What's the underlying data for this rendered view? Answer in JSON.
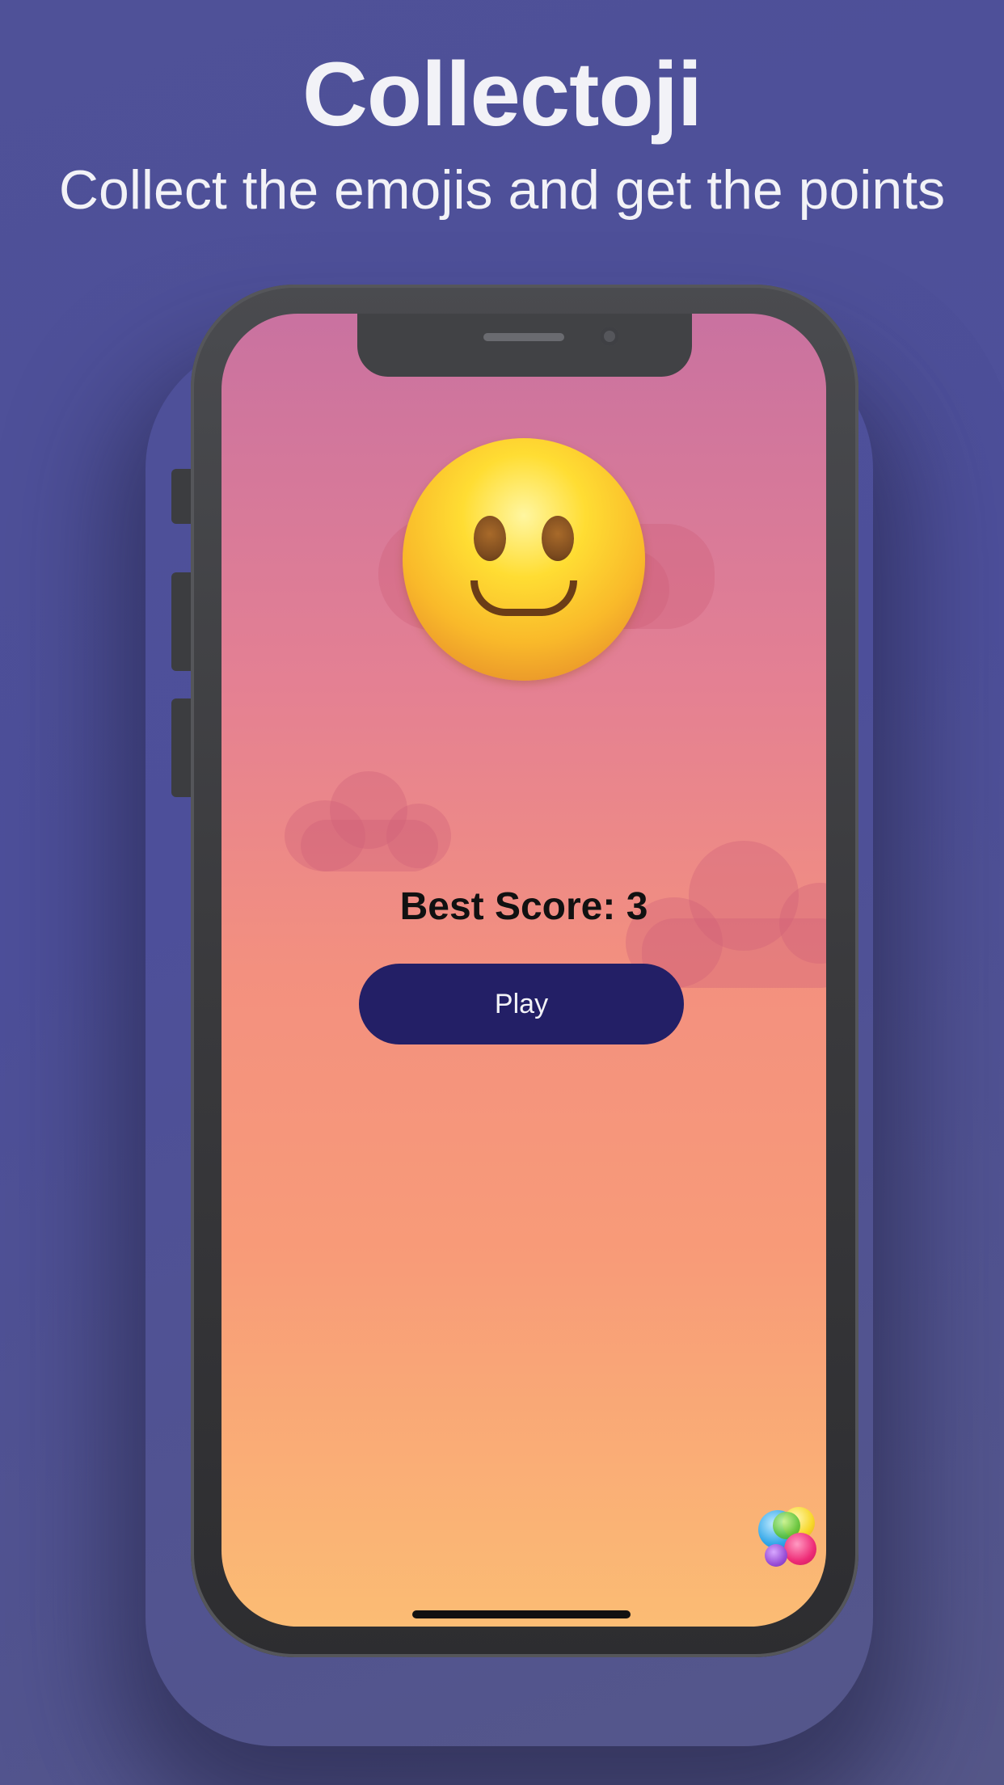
{
  "header": {
    "title": "Collectoji",
    "subtitle": "Collect the emojis and get the points"
  },
  "game": {
    "best_score_text": "Best Score: 3",
    "play_label": "Play",
    "emoji_icon": "slightly-smiling-face-icon",
    "game_center_icon": "game-center-icon"
  },
  "colors": {
    "background": "#4f5198",
    "screen_top": "#c972a0",
    "screen_bottom": "#fbbc74",
    "play_button": "#231f66"
  }
}
